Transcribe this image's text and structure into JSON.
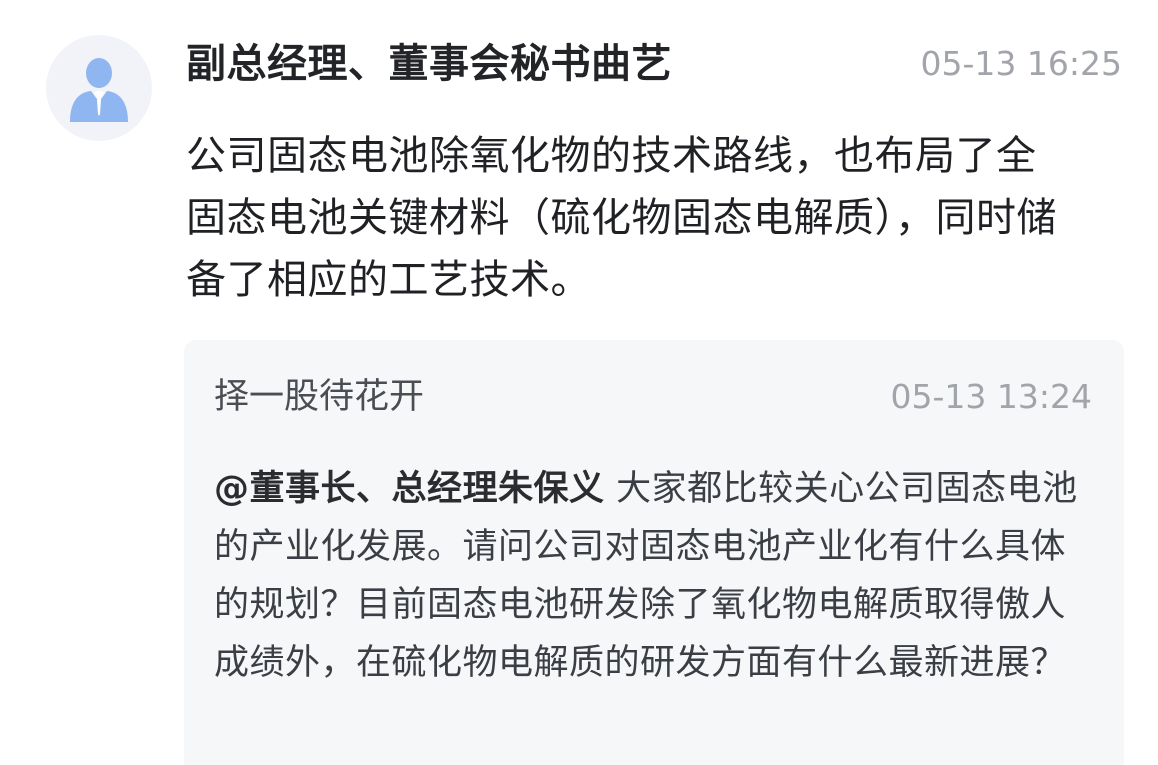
{
  "answer": {
    "avatar_icon": "user-avatar-icon",
    "author": "副总经理、董事会秘书曲艺",
    "time": "05-13 16:25",
    "text": "公司固态电池除氧化物的技术路线，也布局了全固态电池关键材料（硫化物固态电解质），同时储备了相应的工艺技术。"
  },
  "question": {
    "author": "择一股待花开",
    "time": "05-13 13:24",
    "mention": "@董事长、总经理朱保义",
    "text": "大家都比较关心公司固态电池的产业化发展。请问公司对固态电池产业化有什么具体的规划？目前固态电池研发除了氧化物电解质取得傲人成绩外，在硫化物电解质的研发方面有什么最新进展？"
  },
  "colors": {
    "avatar_bg": "#f1f3f8",
    "avatar_icon": "#8fb6f0",
    "quote_bg": "#f6f7f9",
    "time": "#a1a4aa"
  }
}
